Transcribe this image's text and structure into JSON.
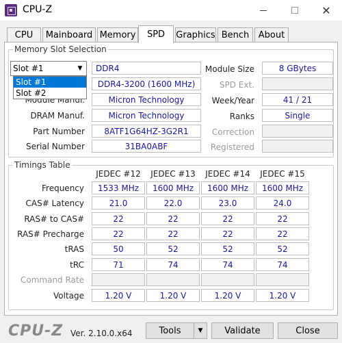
{
  "window": {
    "title": "CPU-Z"
  },
  "tabs": [
    "CPU",
    "Mainboard",
    "Memory",
    "SPD",
    "Graphics",
    "Bench",
    "About"
  ],
  "slot_section": {
    "label": "Memory Slot Selection",
    "selected_slot": "Slot #1",
    "dropdown_options": [
      "Slot #1",
      "Slot #2"
    ],
    "memory_type": "DDR4",
    "module_size_label": "Module Size",
    "module_size": "8 GBytes",
    "max_bandwidth": "DDR4-3200 (1600 MHz)",
    "spd_ext_label": "SPD Ext.",
    "spd_ext": "",
    "module_manuf_label": "Module Manuf.",
    "module_manuf": "Micron Technology",
    "week_year_label": "Week/Year",
    "week_year": "41 / 21",
    "dram_manuf_label": "DRAM Manuf.",
    "dram_manuf": "Micron Technology",
    "ranks_label": "Ranks",
    "ranks": "Single",
    "part_number_label": "Part Number",
    "part_number": "8ATF1G64HZ-3G2R1",
    "correction_label": "Correction",
    "correction": "",
    "serial_number_label": "Serial Number",
    "serial_number": "31BA0ABF",
    "registered_label": "Registered",
    "registered": ""
  },
  "timings": {
    "label": "Timings Table",
    "columns": [
      "JEDEC #12",
      "JEDEC #13",
      "JEDEC #14",
      "JEDEC #15"
    ],
    "rows": [
      {
        "label": "Frequency",
        "values": [
          "1533 MHz",
          "1600 MHz",
          "1600 MHz",
          "1600 MHz"
        ]
      },
      {
        "label": "CAS# Latency",
        "values": [
          "21.0",
          "22.0",
          "23.0",
          "24.0"
        ]
      },
      {
        "label": "RAS# to CAS#",
        "values": [
          "22",
          "22",
          "22",
          "22"
        ]
      },
      {
        "label": "RAS# Precharge",
        "values": [
          "22",
          "22",
          "22",
          "22"
        ]
      },
      {
        "label": "tRAS",
        "values": [
          "50",
          "52",
          "52",
          "52"
        ]
      },
      {
        "label": "tRC",
        "values": [
          "71",
          "74",
          "74",
          "74"
        ]
      },
      {
        "label": "Command Rate",
        "values": [
          "",
          "",
          "",
          ""
        ]
      },
      {
        "label": "Voltage",
        "values": [
          "1.20 V",
          "1.20 V",
          "1.20 V",
          "1.20 V"
        ]
      }
    ]
  },
  "footer": {
    "logo": "CPU-Z",
    "version": "Ver. 2.10.0.x64",
    "tools_label": "Tools",
    "validate_label": "Validate",
    "close_label": "Close"
  },
  "icons": {
    "app": "cpu-z-app-icon",
    "minimize": "minimize-icon",
    "maximize": "maximize-icon",
    "close": "close-icon",
    "dropdown": "chevron-down-icon"
  }
}
